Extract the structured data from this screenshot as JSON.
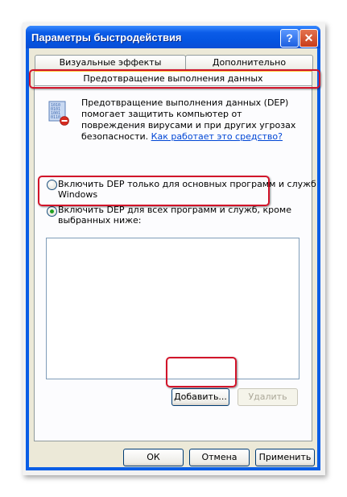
{
  "window": {
    "title": "Параметры быстродействия",
    "help_glyph": "?",
    "close_glyph": "✕"
  },
  "tabs": [
    {
      "label": "Визуальные эффекты",
      "active": false
    },
    {
      "label": "Дополнительно",
      "active": false
    },
    {
      "label": "Предотвращение выполнения данных",
      "active": true
    }
  ],
  "description": {
    "text": "Предотвращение выполнения данных (DEP) помогает защитить компьютер от повреждения вирусами и при других угрозах безопасности. ",
    "link": "Как работает это средство?"
  },
  "options": [
    {
      "label_line1": "Включить DEP только для основных программ и служб",
      "label_line2": "Windows",
      "selected": false
    },
    {
      "label_line1": "Включить DEP для всех программ и служб, кроме",
      "label_line2": "выбранных ниже:",
      "selected": true
    }
  ],
  "exceptions_list": [],
  "buttons": {
    "add": "Добавить...",
    "remove": "Удалить",
    "ok": "ОК",
    "cancel": "Отмена",
    "apply": "Применить"
  },
  "colors": {
    "titlebar": "#0454e0",
    "highlight": "#d2142a",
    "dialog_bg": "#ece9d8",
    "selected_radio": "#21a121"
  }
}
